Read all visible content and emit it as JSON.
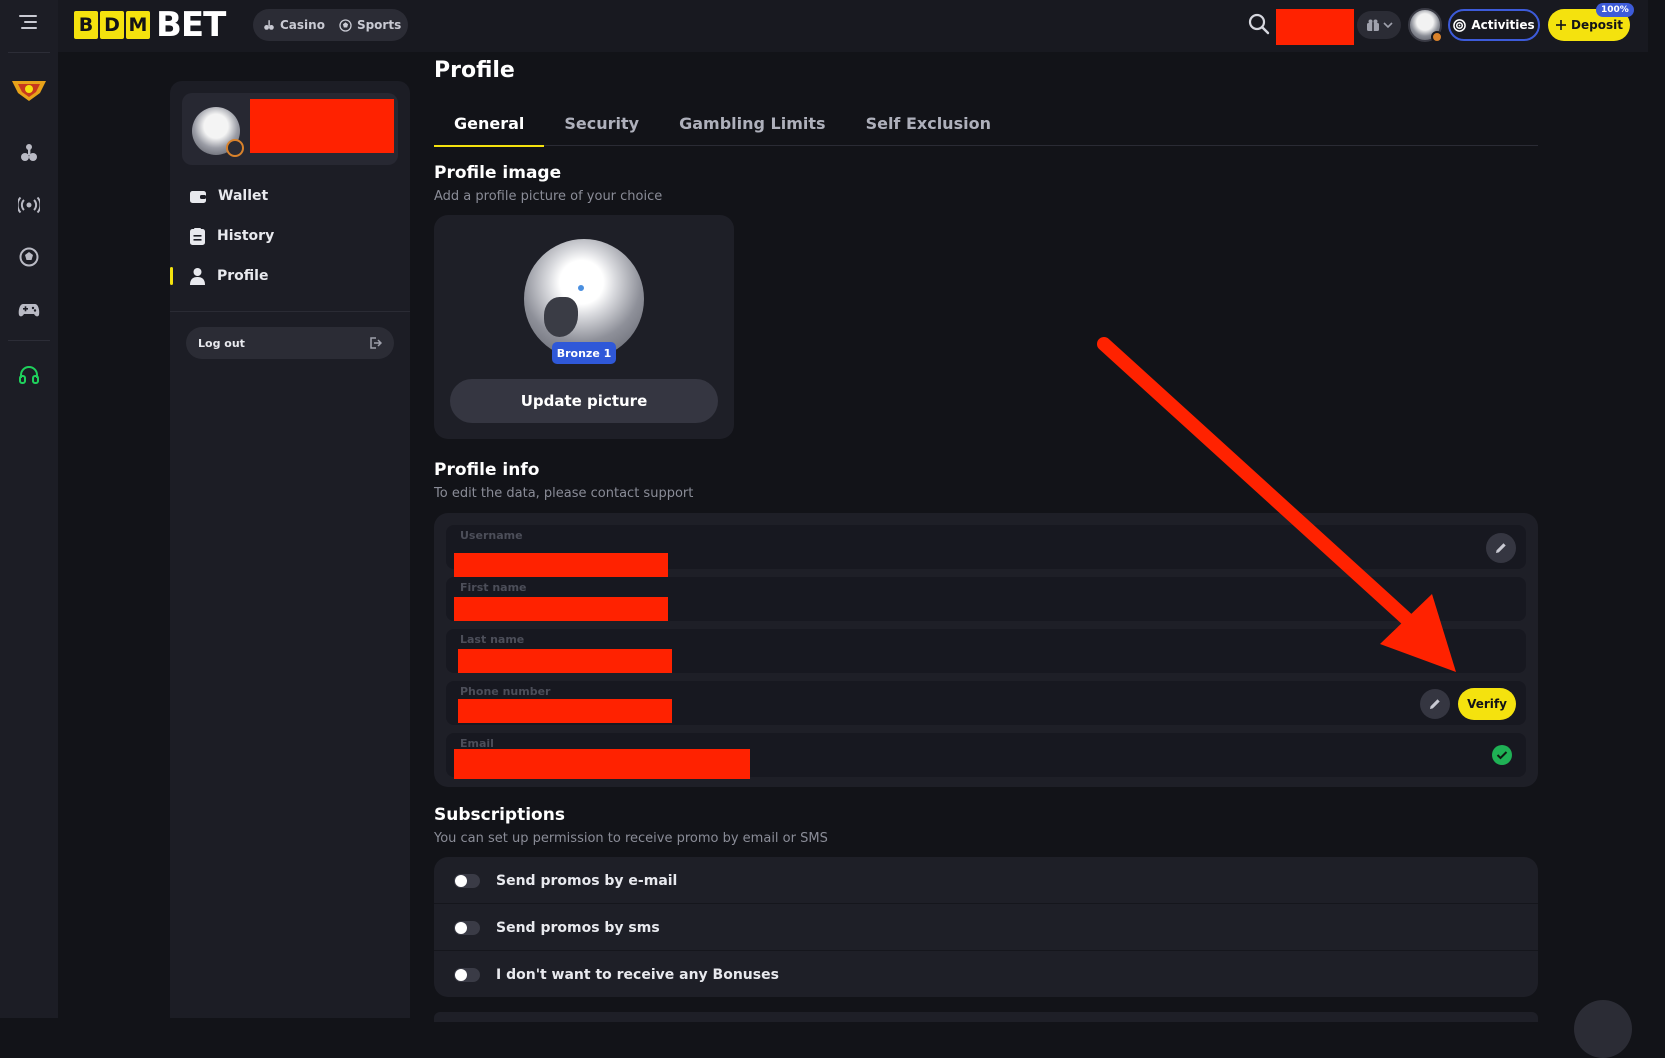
{
  "brand": {
    "logo_letters": [
      "B",
      "D",
      "M"
    ],
    "logo_word": "BET"
  },
  "topbar": {
    "modes": [
      {
        "label": "Casino",
        "icon": "casino-icon"
      },
      {
        "label": "Sports",
        "icon": "soccer-ball-icon"
      }
    ],
    "activities_label": "Activities",
    "deposit_label": "Deposit",
    "deposit_badge": "100%"
  },
  "rail": {
    "icons": [
      "menu-icon",
      "rank-badge-icon",
      "casino-icon",
      "live-icon",
      "soccer-ball-icon",
      "gamepad-icon",
      "support-headset-icon"
    ]
  },
  "sidebar": {
    "items": [
      {
        "label": "Wallet",
        "icon": "wallet-icon",
        "active": false
      },
      {
        "label": "History",
        "icon": "history-icon",
        "active": false
      },
      {
        "label": "Profile",
        "icon": "user-icon",
        "active": true
      }
    ],
    "logout_label": "Log out"
  },
  "main": {
    "title": "Profile",
    "tabs": [
      {
        "label": "General",
        "active": true
      },
      {
        "label": "Security",
        "active": false
      },
      {
        "label": "Gambling Limits",
        "active": false
      },
      {
        "label": "Self Exclusion",
        "active": false
      }
    ],
    "profile_image": {
      "title": "Profile image",
      "subtitle": "Add a profile picture of your choice",
      "level_badge": "Bronze 1",
      "update_label": "Update picture"
    },
    "profile_info": {
      "title": "Profile info",
      "subtitle": "To edit the data, please contact support",
      "fields": [
        {
          "label": "Username",
          "action": "edit"
        },
        {
          "label": "First name",
          "action": ""
        },
        {
          "label": "Last name",
          "action": ""
        },
        {
          "label": "Phone number",
          "action": "edit-verify"
        },
        {
          "label": "Email",
          "action": "verified"
        }
      ],
      "verify_label": "Verify"
    },
    "subscriptions": {
      "title": "Subscriptions",
      "subtitle": "You can set up permission to receive promo by email or SMS",
      "options": [
        {
          "label": "Send promos by e-mail",
          "enabled": false
        },
        {
          "label": "Send promos by sms",
          "enabled": false
        },
        {
          "label": "I don't want to receive any Bonuses",
          "enabled": false
        }
      ]
    }
  },
  "colors": {
    "accent_yellow": "#f4e20e",
    "accent_blue": "#3d5bd9",
    "redaction": "#ff2200",
    "verified_green": "#1fb155",
    "background": "#121318",
    "panel": "#1c1d25"
  }
}
